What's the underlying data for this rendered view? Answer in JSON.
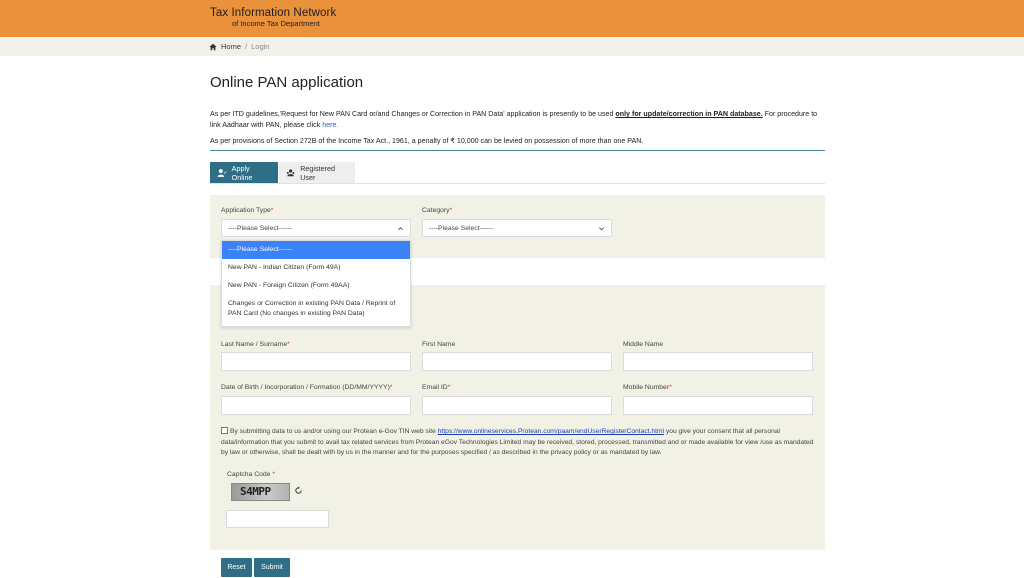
{
  "header": {
    "brand_line1": "Tax Information Network",
    "brand_line2": "of Income Tax Department"
  },
  "breadcrumb": {
    "home": "Home",
    "separator": "/",
    "current": "Login"
  },
  "page": {
    "title": "Online PAN application",
    "notice_part1": "As per ITD guidelines,'Request for New PAN Card or/and Changes or Correction in PAN Data' application is presently to be used ",
    "notice_bold": "only for update/correction in PAN database.",
    "notice_part2": " For procedure to link Aadhaar with PAN, please click ",
    "notice_link": "here.",
    "notice_penalty": "As per provisions of Section 272B of the Income Tax Act., 1961, a penalty of ₹ 10,000 can be levied on possession of more than one PAN."
  },
  "tabs": [
    {
      "label": "Apply Online",
      "active": true
    },
    {
      "label": "Registered User",
      "active": false
    }
  ],
  "form": {
    "application_type": {
      "label": "Application Type",
      "required_mark": "*",
      "value": "----Please Select------",
      "options": [
        "----Please Select------",
        "New PAN - Indian Citizen (Form 49A)",
        "New PAN - Foreign Citizen (Form 49AA)",
        "Changes or Correction in existing PAN Data / Reprint of PAN Card (No changes in existing PAN Data)"
      ]
    },
    "category": {
      "label": "Category",
      "required_mark": "*",
      "value": "----Please Select------"
    },
    "last_name": {
      "label": "Last Name / Surname",
      "required_mark": "*",
      "value": ""
    },
    "first_name": {
      "label": "First Name",
      "value": ""
    },
    "middle_name": {
      "label": "Middle Name",
      "value": ""
    },
    "dob": {
      "label": "Date of Birth / Incorporation / Formation (DD/MM/YYYY)",
      "required_mark": "*",
      "value": ""
    },
    "email": {
      "label": "Email ID",
      "required_mark": "*",
      "value": ""
    },
    "mobile": {
      "label": "Mobile Number",
      "required_mark": "*",
      "value": ""
    },
    "consent_part1": "By submitting data to us and/or using our Protean e-Gov TIN web site ",
    "consent_link": "https://www.onlineservices.Protean.com/paam/endUserRegisterContact.html",
    "consent_part2": " you give your consent that all personal data/information that you submit to avail tax related services from Protean eGov Technologies Limited may be received, stored, processed, transmitted and or made available for view /use as mandated by law or otherwise, shall be dealt with by us in the manner and for the purposes specified / as described in the privacy policy or as mandated by law.",
    "captcha_label": "Captcha Code",
    "captcha_required_mark": "*",
    "captcha_text": "S4MPP",
    "captcha_value": ""
  },
  "buttons": {
    "reset": "Reset",
    "submit": "Submit"
  },
  "colors": {
    "header_bg": "#e9913b",
    "primary": "#2f6f86",
    "panel_bg": "#f1f1e6",
    "dropdown_selected": "#3b82f6"
  }
}
